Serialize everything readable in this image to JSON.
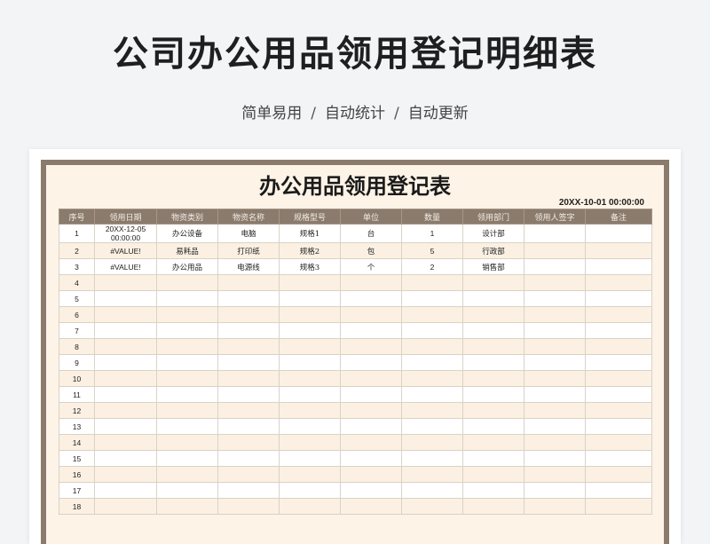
{
  "header": {
    "title": "公司办公用品领用登记明细表",
    "features": [
      "简单易用",
      "自动统计",
      "自动更新"
    ],
    "separator": "/"
  },
  "sheet": {
    "title": "办公用品领用登记表",
    "date": "20XX-10-01 00:00:00",
    "columns": [
      "序号",
      "领用日期",
      "物资类别",
      "物资名称",
      "规格型号",
      "单位",
      "数量",
      "领用部门",
      "领用人签字",
      "备注"
    ],
    "rows": [
      [
        "1",
        "20XX-12-05 00:00:00",
        "办公设备",
        "电脑",
        "规格1",
        "台",
        "1",
        "设计部",
        "",
        ""
      ],
      [
        "2",
        "#VALUE!",
        "易耗品",
        "打印纸",
        "规格2",
        "包",
        "5",
        "行政部",
        "",
        ""
      ],
      [
        "3",
        "#VALUE!",
        "办公用品",
        "电源线",
        "规格3",
        "个",
        "2",
        "销售部",
        "",
        ""
      ],
      [
        "4",
        "",
        "",
        "",
        "",
        "",
        "",
        "",
        "",
        ""
      ],
      [
        "5",
        "",
        "",
        "",
        "",
        "",
        "",
        "",
        "",
        ""
      ],
      [
        "6",
        "",
        "",
        "",
        "",
        "",
        "",
        "",
        "",
        ""
      ],
      [
        "7",
        "",
        "",
        "",
        "",
        "",
        "",
        "",
        "",
        ""
      ],
      [
        "8",
        "",
        "",
        "",
        "",
        "",
        "",
        "",
        "",
        ""
      ],
      [
        "9",
        "",
        "",
        "",
        "",
        "",
        "",
        "",
        "",
        ""
      ],
      [
        "10",
        "",
        "",
        "",
        "",
        "",
        "",
        "",
        "",
        ""
      ],
      [
        "11",
        "",
        "",
        "",
        "",
        "",
        "",
        "",
        "",
        ""
      ],
      [
        "12",
        "",
        "",
        "",
        "",
        "",
        "",
        "",
        "",
        ""
      ],
      [
        "13",
        "",
        "",
        "",
        "",
        "",
        "",
        "",
        "",
        ""
      ],
      [
        "14",
        "",
        "",
        "",
        "",
        "",
        "",
        "",
        "",
        ""
      ],
      [
        "15",
        "",
        "",
        "",
        "",
        "",
        "",
        "",
        "",
        ""
      ],
      [
        "16",
        "",
        "",
        "",
        "",
        "",
        "",
        "",
        "",
        ""
      ],
      [
        "17",
        "",
        "",
        "",
        "",
        "",
        "",
        "",
        "",
        ""
      ],
      [
        "18",
        "",
        "",
        "",
        "",
        "",
        "",
        "",
        "",
        ""
      ]
    ]
  },
  "colors": {
    "frame": "#8a7b6d",
    "sheet_bg": "#fdf3e6",
    "row_alt": "#fbf0e2"
  }
}
